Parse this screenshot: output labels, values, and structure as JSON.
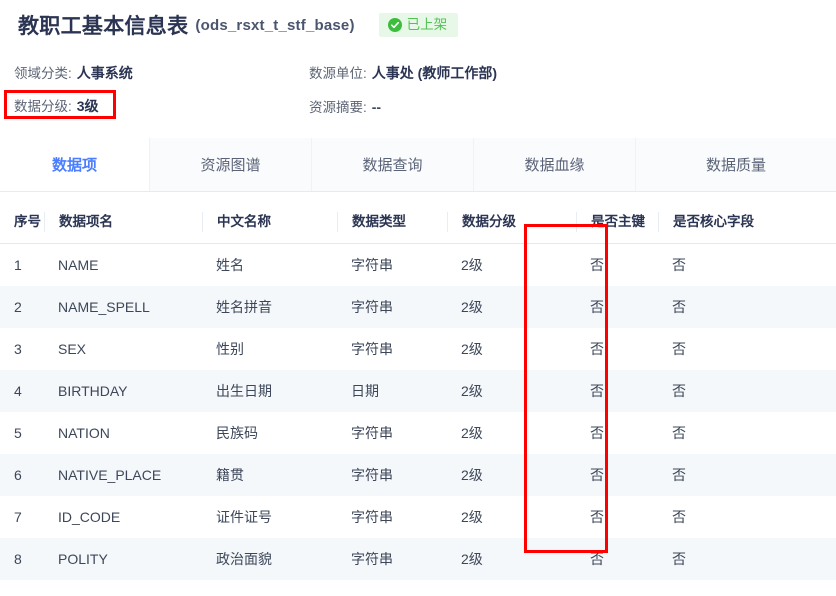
{
  "header": {
    "title": "教职工基本信息表",
    "code": "(ods_rsxt_t_stf_base)",
    "status_label": "已上架",
    "status_color": "#54c254",
    "status_bg": "#e8f8e8"
  },
  "meta": {
    "domain_label": "领域分类:",
    "domain_value": "人事系统",
    "source_label": "数源单位:",
    "source_value": "人事处 (教师工作部)",
    "grade_label": "数据分级:",
    "grade_value": "3级",
    "summary_label": "资源摘要:",
    "summary_value": "--"
  },
  "tabs": [
    {
      "label": "数据项",
      "active": true
    },
    {
      "label": "资源图谱",
      "active": false
    },
    {
      "label": "数据查询",
      "active": false
    },
    {
      "label": "数据血缘",
      "active": false
    },
    {
      "label": "数据质量",
      "active": false
    }
  ],
  "table": {
    "columns": [
      "序号",
      "数据项名",
      "中文名称",
      "数据类型",
      "数据分级",
      "是否主键",
      "是否核心字段"
    ],
    "rows": [
      {
        "idx": "1",
        "name": "NAME",
        "cn": "姓名",
        "type": "字符串",
        "grade": "2级",
        "pk": "否",
        "core": "否"
      },
      {
        "idx": "2",
        "name": "NAME_SPELL",
        "cn": "姓名拼音",
        "type": "字符串",
        "grade": "2级",
        "pk": "否",
        "core": "否"
      },
      {
        "idx": "3",
        "name": "SEX",
        "cn": "性别",
        "type": "字符串",
        "grade": "2级",
        "pk": "否",
        "core": "否"
      },
      {
        "idx": "4",
        "name": "BIRTHDAY",
        "cn": "出生日期",
        "type": "日期",
        "grade": "2级",
        "pk": "否",
        "core": "否"
      },
      {
        "idx": "5",
        "name": "NATION",
        "cn": "民族码",
        "type": "字符串",
        "grade": "2级",
        "pk": "否",
        "core": "否"
      },
      {
        "idx": "6",
        "name": "NATIVE_PLACE",
        "cn": "籍贯",
        "type": "字符串",
        "grade": "2级",
        "pk": "否",
        "core": "否"
      },
      {
        "idx": "7",
        "name": "ID_CODE",
        "cn": "证件证号",
        "type": "字符串",
        "grade": "2级",
        "pk": "否",
        "core": "否"
      },
      {
        "idx": "8",
        "name": "POLITY",
        "cn": "政治面貌",
        "type": "字符串",
        "grade": "2级",
        "pk": "否",
        "core": "否"
      }
    ]
  },
  "annotations": {
    "highlight_color": "#ff0000",
    "boxes": [
      "data-grade-meta",
      "data-grade-column"
    ]
  }
}
